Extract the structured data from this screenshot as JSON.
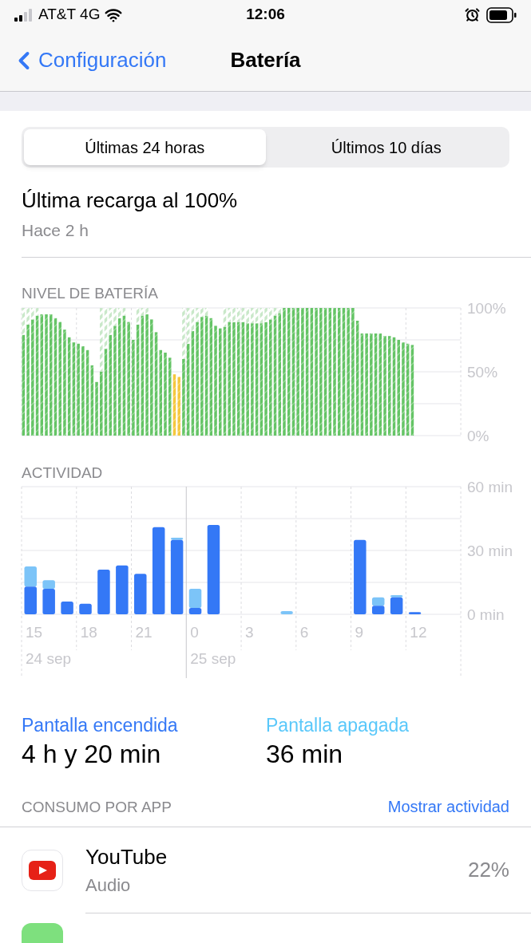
{
  "status_bar": {
    "carrier": "AT&T 4G",
    "time": "12:06"
  },
  "nav": {
    "back": "Configuración",
    "title": "Batería"
  },
  "segments": [
    {
      "label": "Últimas 24 horas",
      "selected": true
    },
    {
      "label": "Últimos 10 días",
      "selected": false
    }
  ],
  "last_charge": {
    "title": "Última recarga al 100%",
    "subtitle": "Hace 2 h"
  },
  "battery_level": {
    "title": "NIVEL DE BATERÍA",
    "chart_data": {
      "type": "bar",
      "stacked": true,
      "ylim": [
        0,
        100
      ],
      "yticks": [
        {
          "value": 0,
          "label": "0%"
        },
        {
          "value": 50,
          "label": "50%"
        },
        {
          "value": 100,
          "label": "100%"
        }
      ],
      "series": [
        {
          "color": "#65c466",
          "values": [
            79,
            87,
            91,
            94,
            95,
            95,
            95,
            92,
            89,
            83,
            77,
            73,
            72,
            70,
            67,
            55,
            42,
            50,
            68,
            79,
            86,
            92,
            94,
            89,
            75,
            87,
            94,
            95,
            91,
            81,
            67,
            65,
            61,
            null,
            null,
            60,
            72,
            82,
            89,
            93,
            94,
            92,
            86,
            84,
            85,
            89,
            89,
            89,
            89,
            88,
            88,
            88,
            88,
            89,
            91,
            94,
            96,
            100,
            100,
            100,
            100,
            100,
            100,
            100,
            100,
            100,
            100,
            100,
            100,
            100,
            100,
            100,
            100,
            90,
            80,
            80,
            80,
            80,
            80,
            78,
            78,
            77,
            75,
            73,
            72,
            71,
            null,
            null,
            null,
            null,
            null,
            null,
            null,
            null,
            null,
            null
          ]
        },
        {
          "color": "#f5c73d",
          "values": [
            null,
            null,
            null,
            null,
            null,
            null,
            null,
            null,
            null,
            null,
            null,
            null,
            null,
            null,
            null,
            null,
            null,
            null,
            null,
            null,
            null,
            null,
            null,
            null,
            null,
            null,
            null,
            null,
            null,
            null,
            null,
            null,
            null,
            48,
            46,
            null,
            null,
            null,
            null,
            null,
            null,
            null,
            null,
            null,
            null,
            null,
            null,
            null,
            null,
            null,
            null,
            null,
            null,
            null,
            null,
            null,
            null,
            null,
            null,
            null,
            null,
            null,
            null,
            null,
            null,
            null,
            null,
            null,
            null,
            null,
            null,
            null,
            null,
            null,
            null,
            null,
            null,
            null,
            null,
            null,
            null,
            null,
            null,
            null,
            null,
            null,
            null,
            null,
            null,
            null,
            null,
            null,
            null,
            null,
            null,
            null
          ]
        },
        {
          "color": "#c9e8c9",
          "values": [
            21,
            13,
            9,
            6,
            null,
            null,
            null,
            null,
            null,
            null,
            null,
            null,
            null,
            null,
            null,
            null,
            null,
            50,
            32,
            21,
            14,
            8,
            6,
            null,
            null,
            13,
            6,
            5,
            null,
            null,
            null,
            null,
            null,
            null,
            null,
            40,
            28,
            18,
            11,
            7,
            6,
            null,
            null,
            null,
            15,
            11,
            11,
            11,
            11,
            12,
            12,
            12,
            12,
            11,
            9,
            6,
            4,
            null,
            null,
            null,
            null,
            null,
            null,
            null,
            null,
            null,
            null,
            null,
            null,
            null,
            null,
            null,
            null,
            null,
            null,
            null,
            null,
            null,
            null,
            null,
            null,
            null,
            null,
            null,
            null,
            null,
            null,
            null,
            null,
            null,
            null,
            null,
            null,
            null,
            null,
            null
          ]
        }
      ]
    }
  },
  "activity": {
    "title": "ACTIVIDAD",
    "chart_data": {
      "type": "bar",
      "stacked": true,
      "ylim": [
        0,
        60
      ],
      "yticks": [
        {
          "value": 0,
          "label": "0 min"
        },
        {
          "value": 30,
          "label": "30 min"
        },
        {
          "value": 60,
          "label": "60 min"
        }
      ],
      "categories": [
        "15",
        null,
        null,
        "18",
        null,
        null,
        "21",
        null,
        null,
        "0",
        null,
        null,
        "3",
        null,
        null,
        "6",
        null,
        null,
        "9",
        null,
        null,
        "12",
        null,
        null
      ],
      "series": [
        {
          "color": "#3478f6",
          "values": [
            13,
            12,
            6,
            5,
            21,
            23,
            19,
            41,
            35,
            3,
            42,
            0,
            0,
            0,
            0,
            0,
            0,
            0,
            35,
            4,
            8,
            1,
            0,
            0
          ]
        },
        {
          "color": "#7cc4f8",
          "values": [
            9.5,
            4,
            0,
            0,
            0,
            0,
            0,
            0,
            1,
            9,
            0,
            0,
            0,
            0,
            1.5,
            0,
            0,
            0,
            0,
            4,
            1,
            0,
            0,
            0
          ]
        }
      ],
      "annotations": [
        "24 sep",
        "25 sep"
      ]
    }
  },
  "summary": [
    {
      "label": "Pantalla encendida",
      "value": "4 h y 20 min",
      "color": "#3478f6"
    },
    {
      "label": "Pantalla apagada",
      "value": "36 min",
      "color": "#5ac8fa"
    }
  ],
  "usage": {
    "title": "CONSUMO POR APP",
    "action": "Mostrar actividad",
    "apps": [
      {
        "kind": "youtube",
        "name": "YouTube",
        "detail": "Audio",
        "percent": "22%"
      },
      {
        "kind": "partial"
      }
    ]
  }
}
